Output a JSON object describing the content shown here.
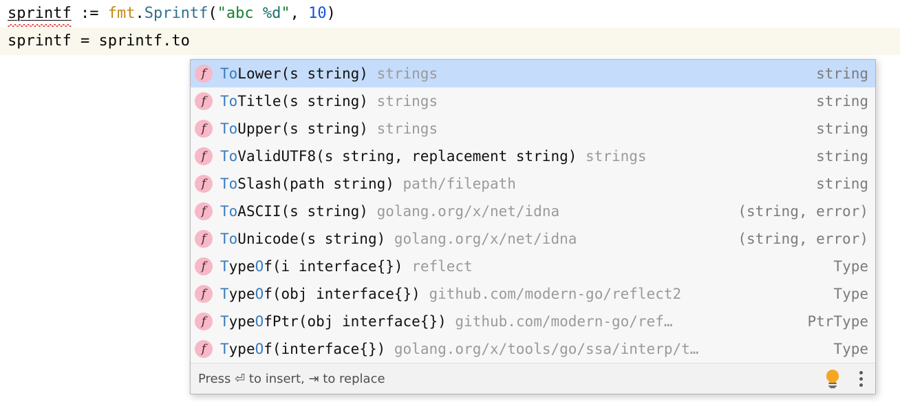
{
  "editor": {
    "lines": [
      {
        "name": "code-line-1",
        "caret": false,
        "tokens": [
          {
            "text": "sprintf",
            "style": "err"
          },
          {
            "text": " := ",
            "style": "plain"
          },
          {
            "text": "fmt",
            "style": "pkg"
          },
          {
            "text": ".",
            "style": "plain"
          },
          {
            "text": "Sprintf",
            "style": "func"
          },
          {
            "text": "(",
            "style": "plain"
          },
          {
            "text": "\"abc ",
            "style": "string"
          },
          {
            "text": "%d",
            "style": "fmt"
          },
          {
            "text": "\"",
            "style": "string"
          },
          {
            "text": ", ",
            "style": "plain"
          },
          {
            "text": "10",
            "style": "num"
          },
          {
            "text": ")",
            "style": "plain"
          }
        ]
      },
      {
        "name": "code-line-2",
        "caret": true,
        "tokens": [
          {
            "text": "sprintf = sprintf.to",
            "style": "plain"
          }
        ]
      }
    ]
  },
  "lookup": {
    "icon_letter": "f",
    "items": [
      {
        "match": "To",
        "sig": "Lower(s string)",
        "pkg": "strings",
        "type": "string",
        "selected": true
      },
      {
        "match": "To",
        "sig": "Title(s string)",
        "pkg": "strings",
        "type": "string",
        "selected": false
      },
      {
        "match": "To",
        "sig": "Upper(s string)",
        "pkg": "strings",
        "type": "string",
        "selected": false
      },
      {
        "match": "To",
        "sig": "ValidUTF8(s string, replacement string)",
        "pkg": "strings",
        "type": "string",
        "selected": false
      },
      {
        "match": "To",
        "sig": "Slash(path string)",
        "pkg": "path/filepath",
        "type": "string",
        "selected": false
      },
      {
        "match": "To",
        "sig": "ASCII(s string)",
        "pkg": "golang.org/x/net/idna",
        "type": "(string, error)",
        "selected": false
      },
      {
        "match": "To",
        "sig": "Unicode(s string)",
        "pkg": "golang.org/x/net/idna",
        "type": "(string, error)",
        "selected": false
      },
      {
        "match": "T",
        "sig": "ype",
        "match2": "O",
        "sig2": "f(i interface{})",
        "pkg": "reflect",
        "type": "Type",
        "selected": false
      },
      {
        "match": "T",
        "sig": "ype",
        "match2": "O",
        "sig2": "f(obj interface{})",
        "pkg": "github.com/modern-go/reflect2",
        "type": "Type",
        "selected": false
      },
      {
        "match": "T",
        "sig": "ype",
        "match2": "O",
        "sig2": "fPtr(obj interface{})",
        "pkg": "github.com/modern-go/ref…",
        "type": "PtrType",
        "selected": false
      },
      {
        "match": "T",
        "sig": "ype",
        "match2": "O",
        "sig2": "f(interface{})",
        "pkg": "golang.org/x/tools/go/ssa/interp/t…",
        "type": "Type",
        "selected": false
      }
    ],
    "footer": {
      "hint": "Press ⏎ to insert, ⇥ to replace",
      "bulb_icon": "lightbulb-icon",
      "menu_icon": "kebab-menu-icon"
    }
  },
  "colors": {
    "selected_row": "#c5dcfa",
    "caret_line": "#faf8ec",
    "match_text": "#3a7cbd",
    "package_text": "#9a9a9a",
    "type_text": "#7b7b7b",
    "icon_bg": "#f7b8c8",
    "bulb": "#f5a623",
    "error_squiggle": "#e04343"
  }
}
